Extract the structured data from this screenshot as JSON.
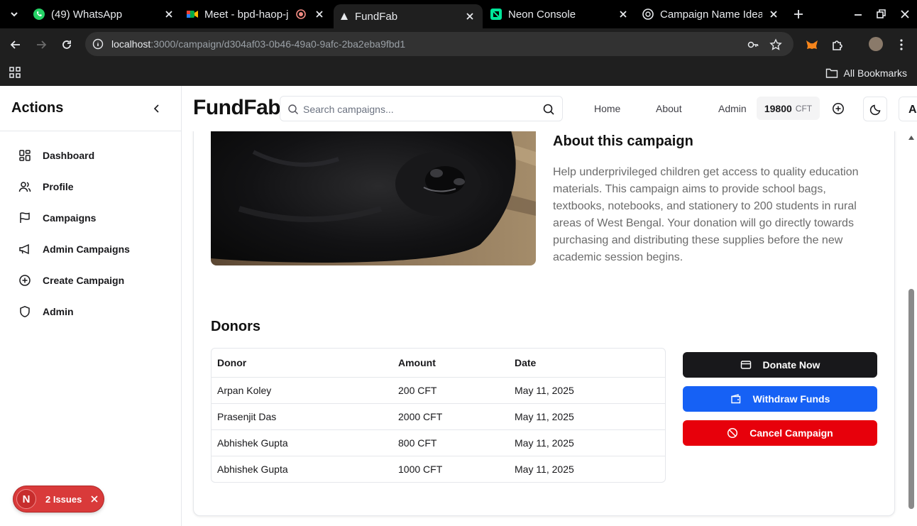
{
  "browser": {
    "tabs": [
      {
        "title": "(49) WhatsApp",
        "icon": "whatsapp-icon"
      },
      {
        "title": "Meet - bpd-haop-j",
        "icon": "meet-icon"
      },
      {
        "title": "FundFab",
        "icon": "fundfab-icon",
        "active": true
      },
      {
        "title": "Neon Console",
        "icon": "neon-icon"
      },
      {
        "title": "Campaign Name Idea",
        "icon": "openai-icon"
      }
    ],
    "url_host": "localhost",
    "url_path": ":3000/campaign/d304af03-0b46-49a0-9afc-2ba2eba9fbd1",
    "bookmarks_label": "All Bookmarks"
  },
  "sidebar": {
    "title": "Actions",
    "items": [
      {
        "label": "Dashboard",
        "icon": "dashboard-icon"
      },
      {
        "label": "Profile",
        "icon": "users-icon"
      },
      {
        "label": "Campaigns",
        "icon": "flag-icon"
      },
      {
        "label": "Admin Campaigns",
        "icon": "megaphone-icon"
      },
      {
        "label": "Create Campaign",
        "icon": "plus-circle-icon"
      },
      {
        "label": "Admin",
        "icon": "shield-icon"
      }
    ]
  },
  "header": {
    "brand": "FundFab",
    "search_placeholder": "Search campaigns...",
    "nav": [
      "Home",
      "About",
      "Admin"
    ],
    "balance_amount": "19800",
    "balance_currency": "CFT",
    "user_initial": "A"
  },
  "campaign": {
    "about_title": "About this campaign",
    "about_text": "Help underprivileged children get access to quality education materials. This campaign aims to provide school bags, textbooks, notebooks, and stationery to 200 students in rural areas of West Bengal. Your donation will go directly towards purchasing and distributing these supplies before the new academic session begins.",
    "donors_title": "Donors",
    "columns": [
      "Donor",
      "Amount",
      "Date"
    ],
    "donors": [
      {
        "name": "Arpan Koley",
        "amount": "200 CFT",
        "date": "May 11, 2025"
      },
      {
        "name": "Prasenjit Das",
        "amount": "2000 CFT",
        "date": "May 11, 2025"
      },
      {
        "name": "Abhishek Gupta",
        "amount": "800 CFT",
        "date": "May 11, 2025"
      },
      {
        "name": "Abhishek Gupta",
        "amount": "1000 CFT",
        "date": "May 11, 2025"
      }
    ],
    "actions": {
      "donate": "Donate Now",
      "withdraw": "Withdraw Funds",
      "cancel": "Cancel Campaign"
    }
  },
  "issues_badge": {
    "initial": "N",
    "label": "2 Issues"
  },
  "colors": {
    "donate": "#18181b",
    "withdraw": "#1661f5",
    "cancel": "#e7000b",
    "issues": "#d93a3a"
  }
}
